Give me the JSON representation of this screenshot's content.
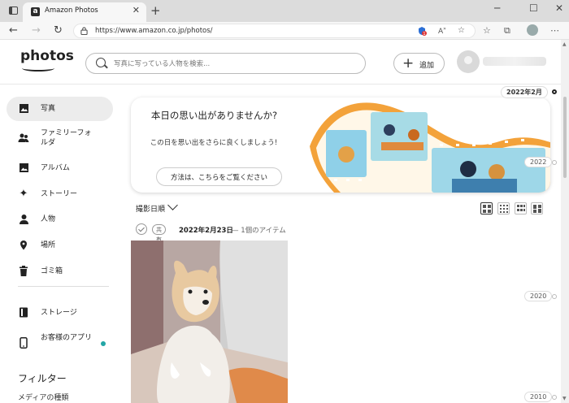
{
  "browser": {
    "tab_title": "Amazon Photos",
    "tab_favicon": "a",
    "url": "https://www.amazon.co.jp/photos/",
    "notif_count": "1"
  },
  "header": {
    "logo": "photos",
    "search_placeholder": "写真に写っている人物を検索...",
    "add_label": "追加"
  },
  "sidebar": {
    "items": [
      {
        "label": "写真",
        "icon": "photo-icon"
      },
      {
        "label": "ファミリーフォルダ",
        "icon": "family-icon"
      },
      {
        "label": "アルバム",
        "icon": "album-icon"
      },
      {
        "label": "ストーリー",
        "icon": "sparkle-icon"
      },
      {
        "label": "人物",
        "icon": "person-icon"
      },
      {
        "label": "場所",
        "icon": "location-pin-icon"
      },
      {
        "label": "ゴミ箱",
        "icon": "trash-icon"
      },
      {
        "label": "ストレージ",
        "icon": "storage-icon"
      },
      {
        "label": "お客様のアプリ",
        "icon": "phone-icon"
      }
    ],
    "filter_title": "フィルター",
    "filter_sub": "メディアの種類"
  },
  "banner": {
    "title": "本日の思い出がありませんか?",
    "subtitle": "この日を思い出をさらに良くしましょう!",
    "button": "方法は、こちらをご覧ください"
  },
  "timeline": {
    "current": "2022年2月",
    "years": [
      "2022",
      "2020",
      "2010"
    ]
  },
  "toolbar": {
    "sort_label": "撮影日順"
  },
  "group": {
    "share_badge": "共有",
    "date": "2022年2月23日",
    "count": "— 1個のアイテム"
  },
  "colors": {
    "accent": "#23a6a6",
    "film_orange": "#f19a2a"
  }
}
